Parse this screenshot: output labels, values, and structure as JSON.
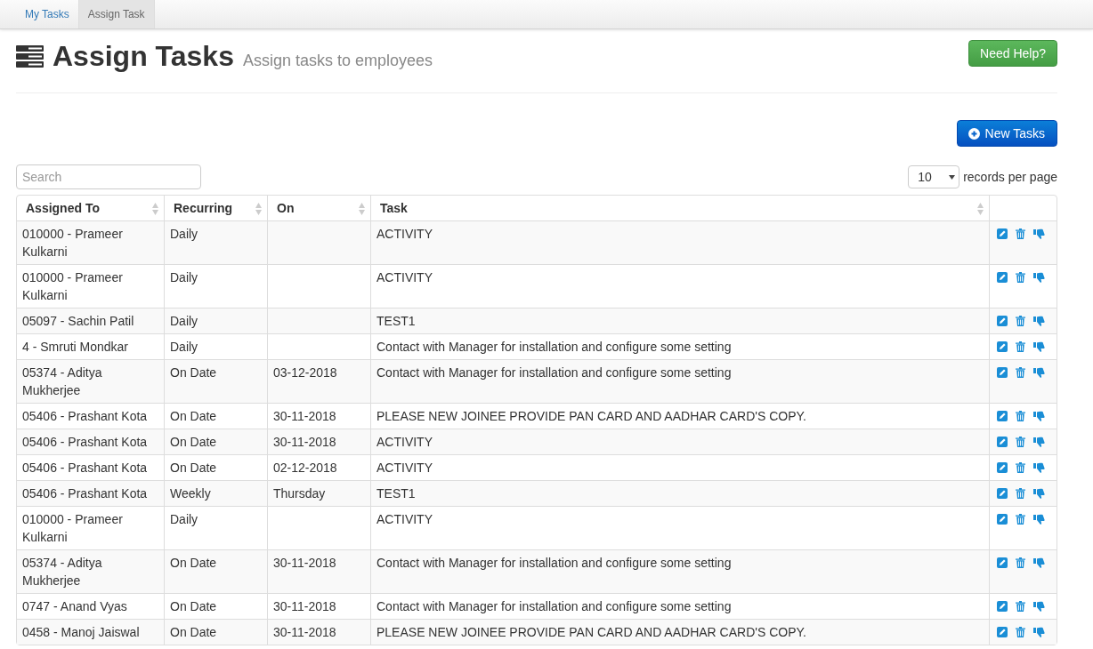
{
  "tabs": [
    {
      "label": "My Tasks",
      "selected": false
    },
    {
      "label": "Assign Task",
      "selected": true
    }
  ],
  "header": {
    "title": "Assign Tasks",
    "subtitle": "Assign tasks to employees",
    "help_button": "Need Help?"
  },
  "new_button": "New Tasks",
  "search": {
    "placeholder": "Search"
  },
  "page_size": {
    "value": "10",
    "label": "records per page"
  },
  "table": {
    "columns": [
      "Assigned To",
      "Recurring",
      "On",
      "Task"
    ],
    "rows": [
      {
        "cells": [
          "010000 - Prameer Kulkarni",
          "Daily",
          "",
          "ACTIVITY"
        ]
      },
      {
        "cells": [
          "010000 - Prameer Kulkarni",
          "Daily",
          "",
          "ACTIVITY"
        ]
      },
      {
        "cells": [
          "05097 - Sachin Patil",
          "Daily",
          "",
          "TEST1"
        ]
      },
      {
        "cells": [
          "4 - Smruti Mondkar",
          "Daily",
          "",
          "Contact with Manager for installation and configure some setting"
        ]
      },
      {
        "cells": [
          "05374 - Aditya Mukherjee",
          "On Date",
          "03-12-2018",
          "Contact with Manager for installation and configure some setting"
        ]
      },
      {
        "cells": [
          "05406 - Prashant Kota",
          "On Date",
          "30-11-2018",
          "PLEASE NEW JOINEE PROVIDE PAN CARD AND AADHAR CARD'S COPY."
        ]
      },
      {
        "cells": [
          "05406 - Prashant Kota",
          "On Date",
          "30-11-2018",
          "ACTIVITY"
        ]
      },
      {
        "cells": [
          "05406 - Prashant Kota",
          "On Date",
          "02-12-2018",
          "ACTIVITY"
        ]
      },
      {
        "cells": [
          "05406 - Prashant Kota",
          "Weekly",
          "Thursday",
          "TEST1"
        ]
      },
      {
        "cells": [
          "010000 - Prameer Kulkarni",
          "Daily",
          "",
          "ACTIVITY"
        ]
      },
      {
        "cells": [
          "05374 - Aditya Mukherjee",
          "On Date",
          "30-11-2018",
          "Contact with Manager for installation and configure some setting"
        ]
      },
      {
        "cells": [
          "0747 - Anand Vyas",
          "On Date",
          "30-11-2018",
          "Contact with Manager for installation and configure some setting"
        ]
      },
      {
        "cells": [
          "0458 - Manoj Jaiswal",
          "On Date",
          "30-11-2018",
          "PLEASE NEW JOINEE PROVIDE PAN CARD AND AADHAR CARD'S COPY."
        ]
      }
    ]
  }
}
